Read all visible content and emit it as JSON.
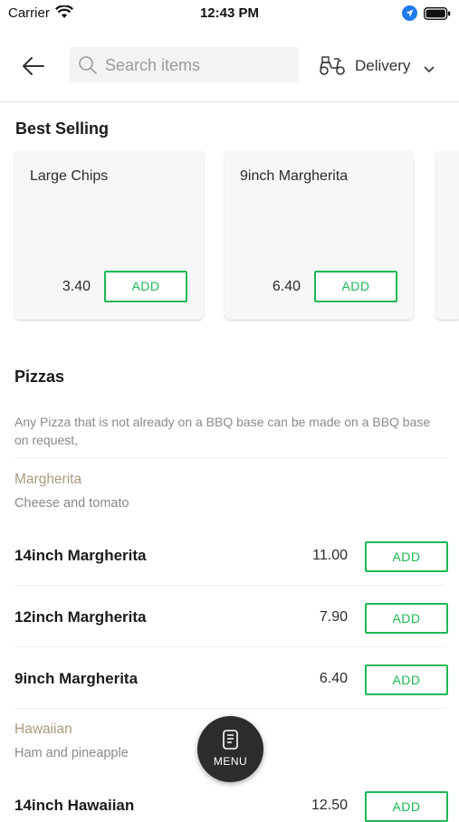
{
  "status_bar": {
    "carrier": "Carrier",
    "time": "12:43 PM"
  },
  "header": {
    "search_placeholder": "Search items",
    "delivery_label": "Delivery"
  },
  "best_selling": {
    "title": "Best Selling",
    "items": [
      {
        "name": "Large Chips",
        "price": "3.40",
        "add_label": "ADD"
      },
      {
        "name": "9inch Margherita",
        "price": "6.40",
        "add_label": "ADD"
      }
    ]
  },
  "pizzas": {
    "title": "Pizzas",
    "note": "Any Pizza that is not already on a BBQ base can be made on a BBQ base on request,",
    "categories": [
      {
        "name": "Margherita",
        "description": "Cheese and tomato",
        "items": [
          {
            "name": "14inch Margherita",
            "price": "11.00",
            "add_label": "ADD"
          },
          {
            "name": "12inch Margherita",
            "price": "7.90",
            "add_label": "ADD"
          },
          {
            "name": "9inch Margherita",
            "price": "6.40",
            "add_label": "ADD"
          }
        ]
      },
      {
        "name": "Hawaiian",
        "description": "Ham and pineapple",
        "items": [
          {
            "name": "14inch Hawaiian",
            "price": "12.50",
            "add_label": "ADD"
          }
        ]
      }
    ]
  },
  "menu_button": {
    "label": "MENU"
  },
  "colors": {
    "accent_green": "#1db954",
    "category_gold": "#a89b7d",
    "fab_dark": "#2c2c2c"
  },
  "icons": [
    "wifi-icon",
    "location-arrow-icon",
    "battery-icon",
    "back-arrow-icon",
    "search-icon",
    "scooter-icon",
    "chevron-down-icon",
    "menu-book-icon"
  ]
}
